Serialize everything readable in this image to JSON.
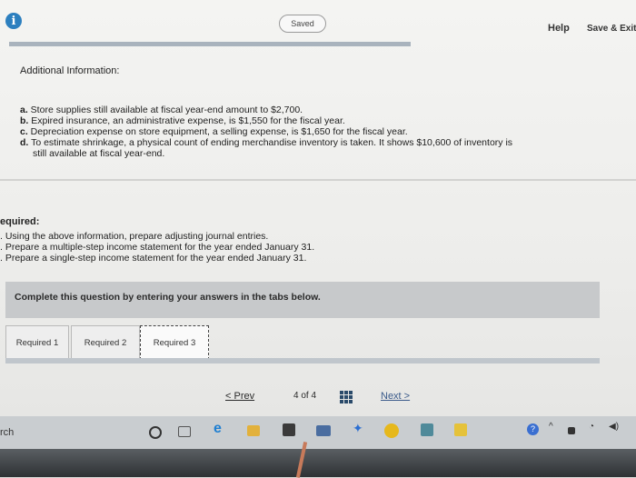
{
  "header": {
    "info_glyph": "i",
    "status": "Saved",
    "help_label": "Help",
    "save_exit_label": "Save & Exit",
    "progress_fraction": 1.0
  },
  "additional": {
    "title": "Additional Information:",
    "items": [
      {
        "letter": "a.",
        "text": " Store supplies still available at fiscal year-end amount to $2,700."
      },
      {
        "letter": "b.",
        "text": " Expired insurance, an administrative expense, is $1,550 for the fiscal year."
      },
      {
        "letter": "c.",
        "text": " Depreciation expense on store equipment, a selling expense, is $1,650 for the fiscal year."
      },
      {
        "letter": "d.",
        "text": " To estimate shrinkage, a physical count of ending merchandise inventory is taken. It shows $10,600 of inventory is"
      }
    ],
    "item_d_continued": "still available at fiscal year-end."
  },
  "required": {
    "title": "equired:",
    "items": [
      ". Using the above information, prepare adjusting journal entries.",
      ". Prepare a multiple-step income statement for the year ended January 31.",
      ". Prepare a single-step income statement for the year ended January 31."
    ]
  },
  "instruction": "Complete this question by entering your answers in the tabs below.",
  "tabs": [
    {
      "label": "Required 1",
      "active": false
    },
    {
      "label": "Required 2",
      "active": false
    },
    {
      "label": "Required 3",
      "active": true
    }
  ],
  "pagination": {
    "prev_label": "< Prev",
    "page_indicator": "4 of 4",
    "next_label": "Next >"
  },
  "taskbar": {
    "search_label": "rch",
    "icons": [
      "cortana-circle-icon",
      "task-view-icon",
      "edge-icon",
      "file-explorer-icon",
      "store-icon",
      "mail-icon",
      "dropbox-icon",
      "chrome-icon",
      "app-icon",
      "sticky-notes-icon",
      "help-icon",
      "chevron-up-icon",
      "battery-icon",
      "wifi-icon",
      "volume-icon"
    ],
    "colors": {
      "edge": "#1f7fd1",
      "chrome": "#e6b81c",
      "dropbox": "#2c6fd1",
      "store": "#3b3b3b",
      "help": "#3a6fd1"
    }
  }
}
